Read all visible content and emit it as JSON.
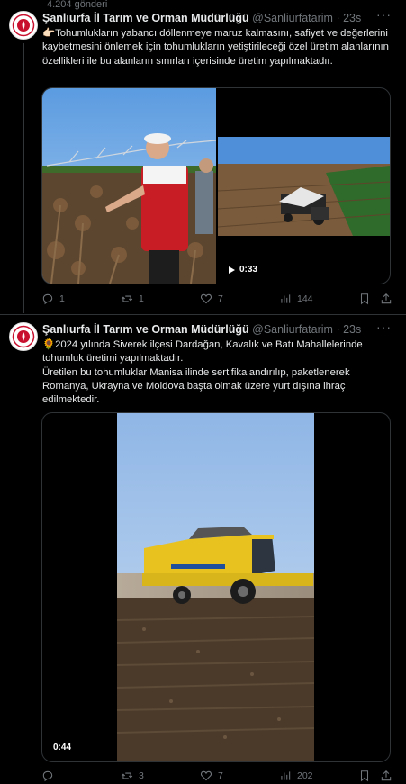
{
  "top_count": "4.204 gönderi",
  "tweets": [
    {
      "name": "Şanlıurfa İl Tarım ve Orman Müdürlüğü",
      "handle": "@Sanliurfatarim",
      "time": "23s",
      "lines": [
        "👉🏻Tohumlukların yabancı döllenmeye maruz kalmasını, safiyet ve değerlerini kaybetmesini önlemek için tohumlukların yetiştirileceği özel üretim alanlarının özellikleri ile bu alanların sınırları içerisinde üretim yapılmaktadır."
      ],
      "video_duration": "0:33",
      "replies": "1",
      "retweets": "1",
      "likes": "7",
      "views": "144"
    },
    {
      "name": "Şanlıurfa İl Tarım ve Orman Müdürlüğü",
      "handle": "@Sanliurfatarim",
      "time": "23s",
      "lines": [
        "🌻2024 yılında Siverek ilçesi Dardağan, Kavalık ve Batı Mahallelerinde tohumluk üretimi yapılmaktadır.",
        "Üretilen bu tohumluklar Manisa ilinde sertifikalandırılıp, paketlenerek Romanya, Ukrayna ve Moldova başta olmak üzere yurt dışına ihraç edilmektedir."
      ],
      "video_duration": "0:44",
      "replies": "",
      "retweets": "3",
      "likes": "7",
      "views": "202"
    }
  ],
  "colors": {
    "text": "#e7e9ea",
    "muted": "#71767b",
    "border": "#2f3336",
    "bg": "#000000"
  },
  "icons": [
    "ministry-logo-icon",
    "more-icon",
    "play-icon",
    "reply-icon",
    "retweet-icon",
    "like-icon",
    "views-icon",
    "bookmark-icon",
    "share-icon"
  ]
}
